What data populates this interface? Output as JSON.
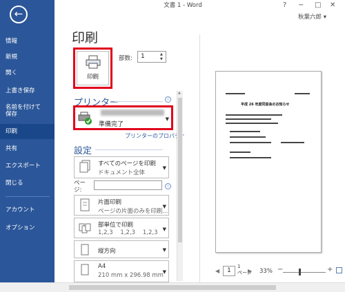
{
  "window": {
    "title": "文書 1 - Word",
    "help": "?",
    "minimize": "−",
    "restore": "□",
    "close": "✕",
    "user": "秋葉六郎 ▾"
  },
  "sidebar": {
    "back": "←",
    "items": [
      {
        "label": "情報"
      },
      {
        "label": "新規"
      },
      {
        "label": "開く"
      },
      {
        "label": "上書き保存"
      },
      {
        "label": "名前を付けて\n保存"
      },
      {
        "label": "印刷"
      },
      {
        "label": "共有"
      },
      {
        "label": "エクスポート"
      },
      {
        "label": "閉じる"
      },
      {
        "label": "アカウント"
      },
      {
        "label": "オプション"
      }
    ]
  },
  "main": {
    "heading": "印刷",
    "print_button": "印刷",
    "copies_label": "部数:",
    "copies_value": "1",
    "printer_section": "プリンター",
    "printer_status": "準備完了",
    "printer_properties": "プリンターのプロパティ",
    "settings_section": "設定",
    "settings": [
      {
        "l1": "すべてのページを印刷",
        "l2": "ドキュメント全体"
      },
      {
        "l1": "片面印刷",
        "l2": "ページの片面のみを印刷..."
      },
      {
        "l1": "部単位で印刷",
        "l2": "1,2,3    1,2,3    1,2,3"
      },
      {
        "l1": "縦方向",
        "l2": ""
      },
      {
        "l1": "A4",
        "l2": "210 mm x 296.98 mm"
      }
    ],
    "pages_label": "ペー\nジ:"
  },
  "preview": {
    "page_value": "1",
    "page_of": "1\nページ",
    "zoom": "33%",
    "title_text": "平成 26 年度同窓会のお知らせ"
  },
  "colors": {
    "sidebar": "#2b579a",
    "accent": "#2b579a",
    "highlight": "#e0001a"
  }
}
